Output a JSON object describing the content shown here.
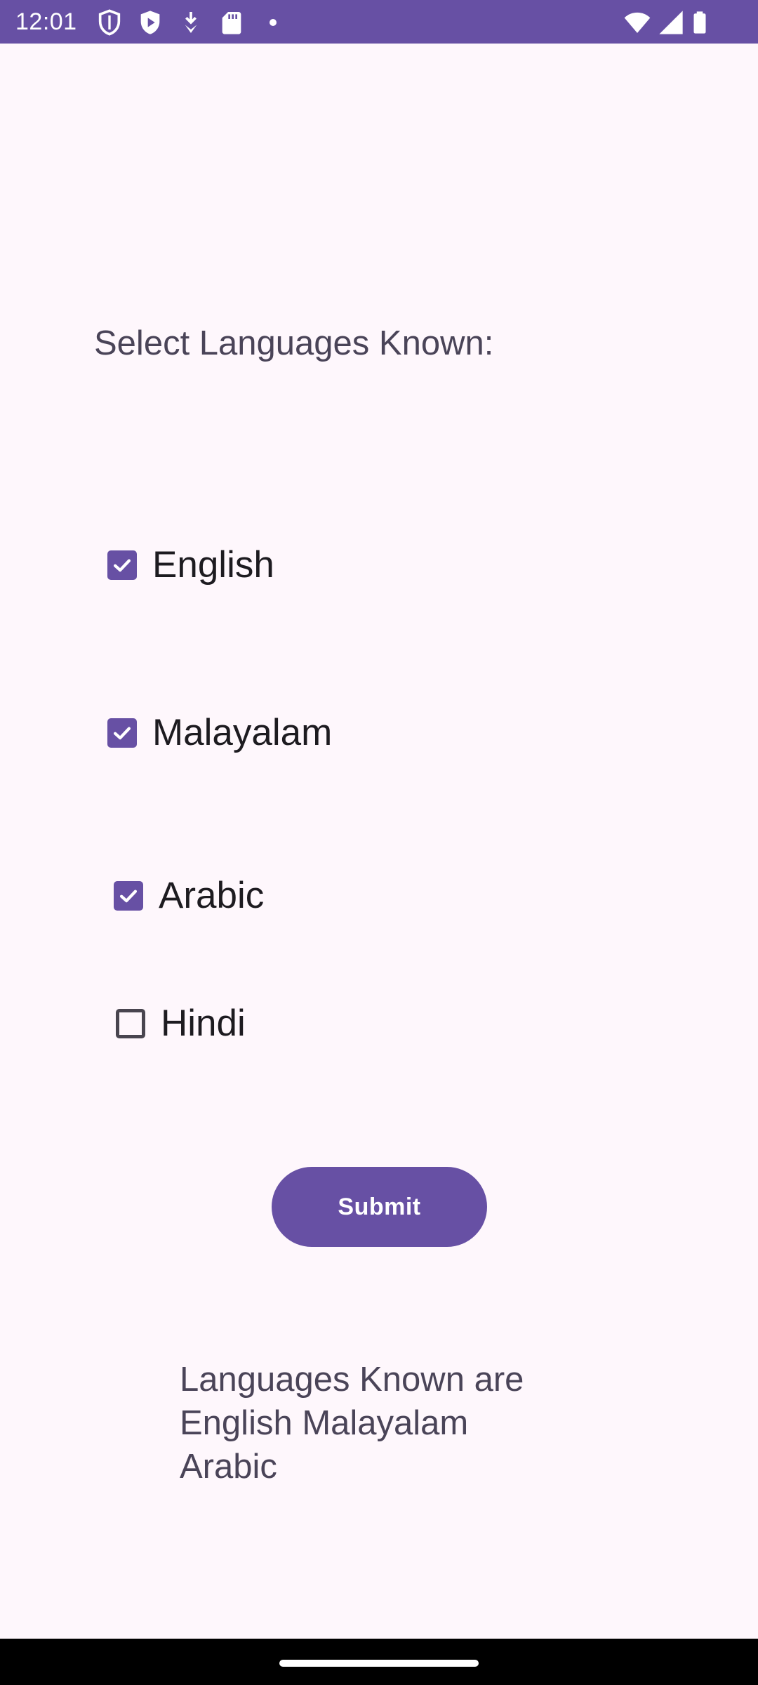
{
  "status_bar": {
    "time": "12:01",
    "icons_left": [
      "shield-icon",
      "play-protect-icon",
      "download-icon",
      "sd-card-icon",
      "dot-icon"
    ],
    "icons_right": [
      "wifi-icon",
      "signal-icon",
      "battery-icon"
    ],
    "color": "#6750A4"
  },
  "screen": {
    "heading": "Select Languages Known:",
    "checkboxes": [
      {
        "label": "English",
        "checked": true
      },
      {
        "label": "Malayalam",
        "checked": true
      },
      {
        "label": "Arabic",
        "checked": true
      },
      {
        "label": "Hindi",
        "checked": false
      }
    ],
    "submit_label": "Submit",
    "result_text": "Languages Known are English Malayalam Arabic"
  },
  "colors": {
    "accent": "#6750A4",
    "background": "#FEF7FC"
  }
}
